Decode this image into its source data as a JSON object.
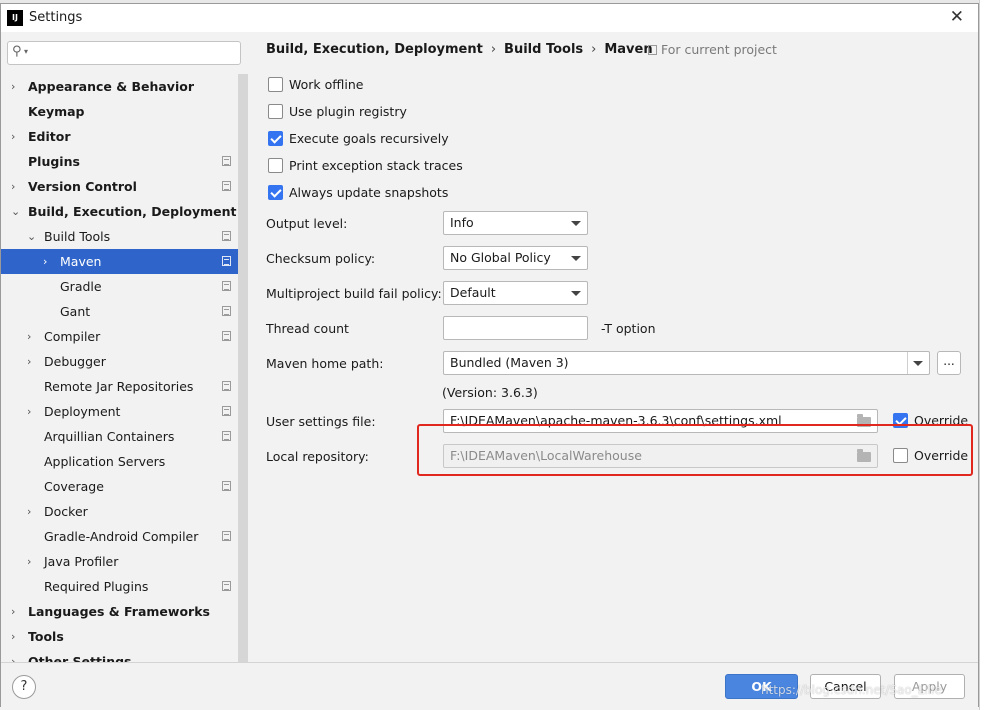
{
  "window": {
    "title": "Settings",
    "app_icon": "IJ",
    "close": "✕"
  },
  "search": {
    "icon": "search-icon",
    "value": ""
  },
  "tree": [
    {
      "label": "Appearance & Behavior",
      "level": 0,
      "bold": true,
      "arrow": "›",
      "project": false
    },
    {
      "label": "Keymap",
      "level": 0,
      "bold": true,
      "arrow": "",
      "project": false
    },
    {
      "label": "Editor",
      "level": 0,
      "bold": true,
      "arrow": "›",
      "project": false
    },
    {
      "label": "Plugins",
      "level": 0,
      "bold": true,
      "arrow": "",
      "project": true
    },
    {
      "label": "Version Control",
      "level": 0,
      "bold": true,
      "arrow": "›",
      "project": true
    },
    {
      "label": "Build, Execution, Deployment",
      "level": 0,
      "bold": true,
      "arrow": "⌄",
      "project": false
    },
    {
      "label": "Build Tools",
      "level": 1,
      "bold": false,
      "arrow": "⌄",
      "project": true
    },
    {
      "label": "Maven",
      "level": 2,
      "bold": false,
      "arrow": "›",
      "project": true,
      "selected": true
    },
    {
      "label": "Gradle",
      "level": 2,
      "bold": false,
      "arrow": "",
      "project": true
    },
    {
      "label": "Gant",
      "level": 2,
      "bold": false,
      "arrow": "",
      "project": true
    },
    {
      "label": "Compiler",
      "level": 1,
      "bold": false,
      "arrow": "›",
      "project": true
    },
    {
      "label": "Debugger",
      "level": 1,
      "bold": false,
      "arrow": "›",
      "project": false
    },
    {
      "label": "Remote Jar Repositories",
      "level": 1,
      "bold": false,
      "arrow": "",
      "project": true
    },
    {
      "label": "Deployment",
      "level": 1,
      "bold": false,
      "arrow": "›",
      "project": true
    },
    {
      "label": "Arquillian Containers",
      "level": 1,
      "bold": false,
      "arrow": "",
      "project": true
    },
    {
      "label": "Application Servers",
      "level": 1,
      "bold": false,
      "arrow": "",
      "project": false
    },
    {
      "label": "Coverage",
      "level": 1,
      "bold": false,
      "arrow": "",
      "project": true
    },
    {
      "label": "Docker",
      "level": 1,
      "bold": false,
      "arrow": "›",
      "project": false
    },
    {
      "label": "Gradle-Android Compiler",
      "level": 1,
      "bold": false,
      "arrow": "",
      "project": true
    },
    {
      "label": "Java Profiler",
      "level": 1,
      "bold": false,
      "arrow": "›",
      "project": false
    },
    {
      "label": "Required Plugins",
      "level": 1,
      "bold": false,
      "arrow": "",
      "project": true
    },
    {
      "label": "Languages & Frameworks",
      "level": 0,
      "bold": true,
      "arrow": "›",
      "project": false
    },
    {
      "label": "Tools",
      "level": 0,
      "bold": true,
      "arrow": "›",
      "project": false
    },
    {
      "label": "Other Settings",
      "level": 0,
      "bold": true,
      "arrow": "›",
      "project": false
    }
  ],
  "breadcrumb": {
    "part1": "Build, Execution, Deployment",
    "part2": "Build Tools",
    "part3": "Maven",
    "sep": "›",
    "scope": "For current project"
  },
  "checkboxes": {
    "work_offline": {
      "label": "Work offline",
      "checked": false
    },
    "plugin_registry": {
      "label": "Use plugin registry",
      "checked": false
    },
    "goals_recursive": {
      "label": "Execute goals recursively",
      "checked": true
    },
    "print_traces": {
      "label": "Print exception stack traces",
      "checked": false
    },
    "update_snapshots": {
      "label": "Always update snapshots",
      "checked": true
    }
  },
  "fields": {
    "output_level": {
      "label": "Output level:",
      "value": "Info"
    },
    "checksum": {
      "label": "Checksum policy:",
      "value": "No Global Policy"
    },
    "fail_policy": {
      "label": "Multiproject build fail policy:",
      "value": "Default"
    },
    "thread_count": {
      "label": "Thread count",
      "value": "",
      "suffix": "-T option"
    },
    "maven_home": {
      "label": "Maven home path:",
      "value": "Bundled (Maven 3)",
      "browse": "...",
      "version": "(Version: 3.6.3)"
    },
    "user_settings": {
      "label": "User settings file:",
      "value": "F:\\IDEAMaven\\apache-maven-3.6.3\\conf\\settings.xml",
      "override_label": "Override",
      "override": true
    },
    "local_repo": {
      "label": "Local repository:",
      "value": "F:\\IDEAMaven\\LocalWarehouse",
      "override_label": "Override",
      "override": false
    }
  },
  "buttons": {
    "help": "?",
    "ok": "OK",
    "cancel": "Cancel",
    "apply": "Apply"
  },
  "watermark": "https://blog.csdn.net/Sao_Lilie",
  "colors": {
    "accent": "#2f65ca",
    "checkbox": "#3574f0",
    "highlight": "#e0281f"
  }
}
